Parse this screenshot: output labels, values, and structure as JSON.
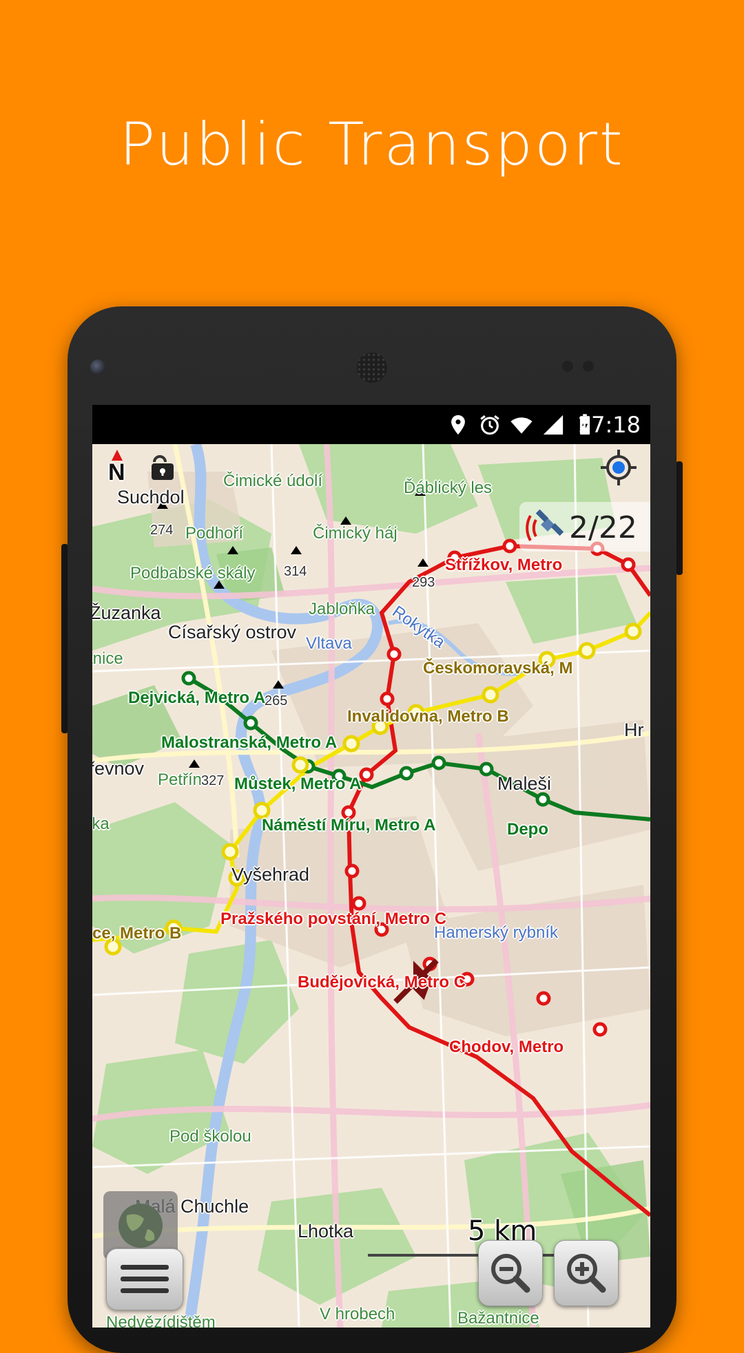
{
  "headline": "Public Transport",
  "statusbar": {
    "time": "17:18",
    "icons": [
      "location-icon",
      "alarm-icon",
      "wifi-icon",
      "signal-icon",
      "battery-charging-icon"
    ]
  },
  "map": {
    "compass_letter": "N",
    "satellites": "2/22",
    "scale": "5 km",
    "places": [
      "Suchdol",
      "Podhoří",
      "Čimický háj",
      "Čimické údolí",
      "Ďáblický les",
      "Císařský ostrov",
      "Žuzanka",
      "Vyšehrad",
      "Malá Chuchle",
      "Lhotka",
      "Hr",
      "Maleši",
      "řevnov",
      "tnice",
      "lka",
      "Nedvězídištěm",
      "Bažantnice"
    ],
    "nature_labels": [
      "Podbabské skály",
      "Jabloňka",
      "Petřín",
      "Pod školou",
      "V hrobech"
    ],
    "water_labels": [
      "Vltava",
      "Rokytka",
      "Hamerský rybník"
    ],
    "elevations": [
      "274",
      "314",
      "293",
      "265",
      "327"
    ],
    "stations": {
      "red": [
        "Střížkov, Metro",
        "Pražského povstání, Metro C",
        "Budějovická, Metro C",
        "Chodov, Metro"
      ],
      "green": [
        "Dejvická, Metro A",
        "Malostranská, Metro A",
        "Můstek, Metro A",
        "Náměstí Míru, Metro A",
        "Depo"
      ],
      "yellow": [
        "Invalidovna, Metro B",
        "Českomoravská, M",
        "ce, Metro B"
      ]
    }
  },
  "colors": {
    "background": "#FF8A00",
    "line_red": "#e01515",
    "line_green": "#0c7a20",
    "line_yellow": "#f4e400"
  }
}
